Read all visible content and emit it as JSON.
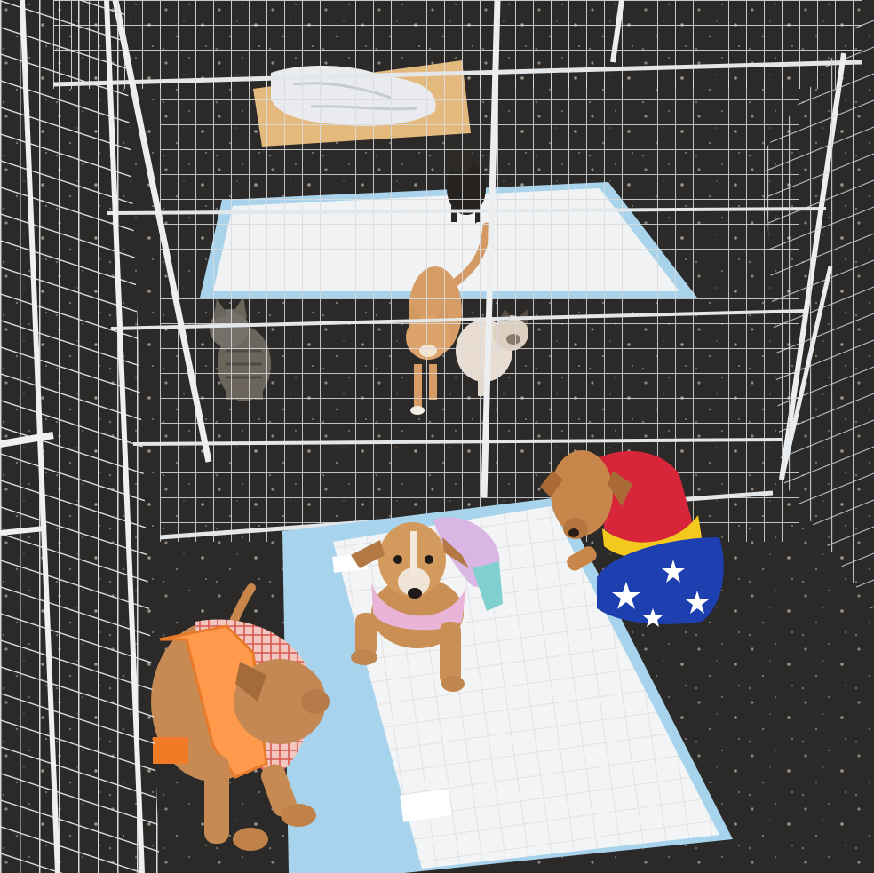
{
  "scene": {
    "alt": "",
    "colors": {
      "ground": "#2b2a28",
      "wire": "#d9dde0",
      "pad_blue": "#a9d4ea",
      "pad_white": "#f2f3f4",
      "board": "#e0b77c"
    }
  }
}
